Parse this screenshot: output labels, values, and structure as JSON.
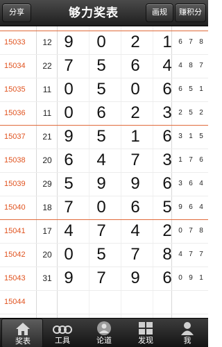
{
  "header": {
    "share_label": "分享",
    "title": "够力奖表",
    "rules_label": "画规",
    "earn_label": "赚积分"
  },
  "rows": [
    {
      "issue": "15033",
      "sum": "12",
      "big": [
        "9",
        "0",
        "2",
        "1"
      ],
      "small": [
        "6",
        "7",
        "8"
      ]
    },
    {
      "issue": "15034",
      "sum": "22",
      "big": [
        "7",
        "5",
        "6",
        "4"
      ],
      "small": [
        "4",
        "8",
        "7"
      ]
    },
    {
      "issue": "15035",
      "sum": "11",
      "big": [
        "0",
        "5",
        "0",
        "6"
      ],
      "small": [
        "6",
        "5",
        "1"
      ]
    },
    {
      "issue": "15036",
      "sum": "11",
      "big": [
        "0",
        "6",
        "2",
        "3"
      ],
      "small": [
        "2",
        "5",
        "2"
      ]
    },
    {
      "issue": "15037",
      "sum": "21",
      "big": [
        "9",
        "5",
        "1",
        "6"
      ],
      "small": [
        "3",
        "1",
        "5"
      ]
    },
    {
      "issue": "15038",
      "sum": "20",
      "big": [
        "6",
        "4",
        "7",
        "3"
      ],
      "small": [
        "1",
        "7",
        "6"
      ]
    },
    {
      "issue": "15039",
      "sum": "29",
      "big": [
        "5",
        "9",
        "9",
        "6"
      ],
      "small": [
        "3",
        "6",
        "4"
      ]
    },
    {
      "issue": "15040",
      "sum": "18",
      "big": [
        "7",
        "0",
        "6",
        "5"
      ],
      "small": [
        "9",
        "6",
        "4"
      ]
    },
    {
      "issue": "15041",
      "sum": "17",
      "big": [
        "4",
        "7",
        "4",
        "2"
      ],
      "small": [
        "0",
        "7",
        "8"
      ]
    },
    {
      "issue": "15042",
      "sum": "20",
      "big": [
        "0",
        "5",
        "7",
        "8"
      ],
      "small": [
        "4",
        "7",
        "7"
      ]
    },
    {
      "issue": "15043",
      "sum": "31",
      "big": [
        "9",
        "7",
        "9",
        "6"
      ],
      "small": [
        "0",
        "9",
        "1"
      ]
    },
    {
      "issue": "15044",
      "sum": "",
      "big": [
        "",
        "",
        "",
        ""
      ],
      "small": [
        "",
        "",
        ""
      ]
    }
  ],
  "tabs": [
    {
      "label": "奖表",
      "icon": "home-icon",
      "active": true
    },
    {
      "label": "工具",
      "icon": "tools-icon",
      "active": false
    },
    {
      "label": "论道",
      "icon": "forum-icon",
      "active": false
    },
    {
      "label": "发现",
      "icon": "discover-icon",
      "active": false
    },
    {
      "label": "我",
      "icon": "profile-icon",
      "active": false
    }
  ],
  "colors": {
    "issue": "#e0531f",
    "group_line": "#e06a3a",
    "header_bg": "#2b2b2b"
  }
}
